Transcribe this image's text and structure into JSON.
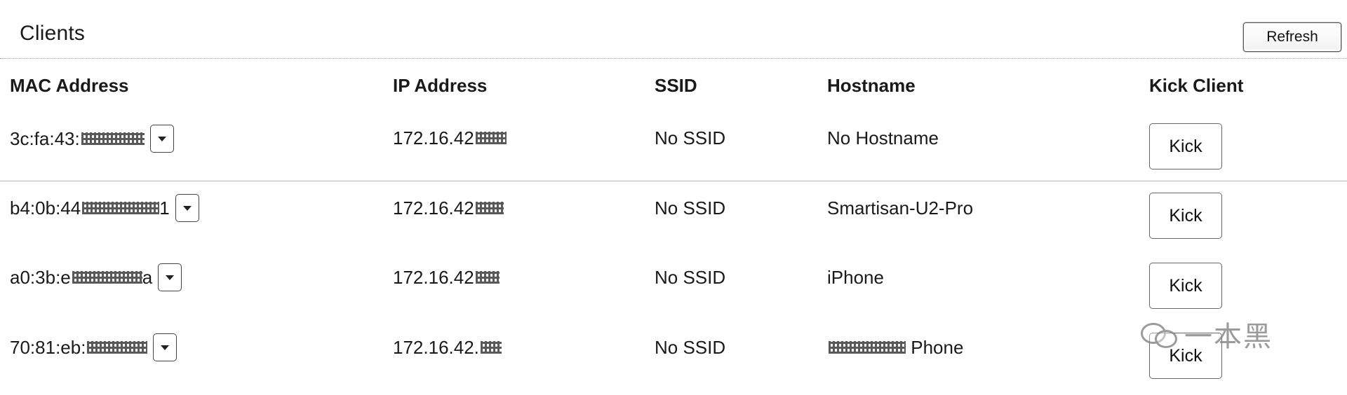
{
  "header": {
    "title": "Clients",
    "refresh_label": "Refresh"
  },
  "table": {
    "columns": [
      "MAC Address",
      "IP Address",
      "SSID",
      "Hostname",
      "Kick Client"
    ],
    "rows": [
      {
        "mac": "3c:fa:43:",
        "mac_suffix": "",
        "ip": "172.16.42",
        "ssid": "No SSID",
        "hostname": "No Hostname",
        "hostname_prefix": "",
        "kick_label": "Kick"
      },
      {
        "mac": "b4:0b:44",
        "mac_suffix": "1",
        "ip": "172.16.42",
        "ssid": "No SSID",
        "hostname": "Smartisan-U2-Pro",
        "hostname_prefix": "",
        "kick_label": "Kick"
      },
      {
        "mac": "a0:3b:e",
        "mac_suffix": "a",
        "ip": "172.16.42",
        "ssid": "No SSID",
        "hostname": "iPhone",
        "hostname_prefix": "",
        "kick_label": "Kick"
      },
      {
        "mac": "70:81:eb:",
        "mac_suffix": "",
        "ip": "172.16.42.",
        "ssid": "No SSID",
        "hostname": "Phone",
        "hostname_prefix": "",
        "kick_label": "Kick"
      }
    ]
  },
  "watermark": {
    "text": "一本黑",
    "icon": "wechat-icon"
  }
}
